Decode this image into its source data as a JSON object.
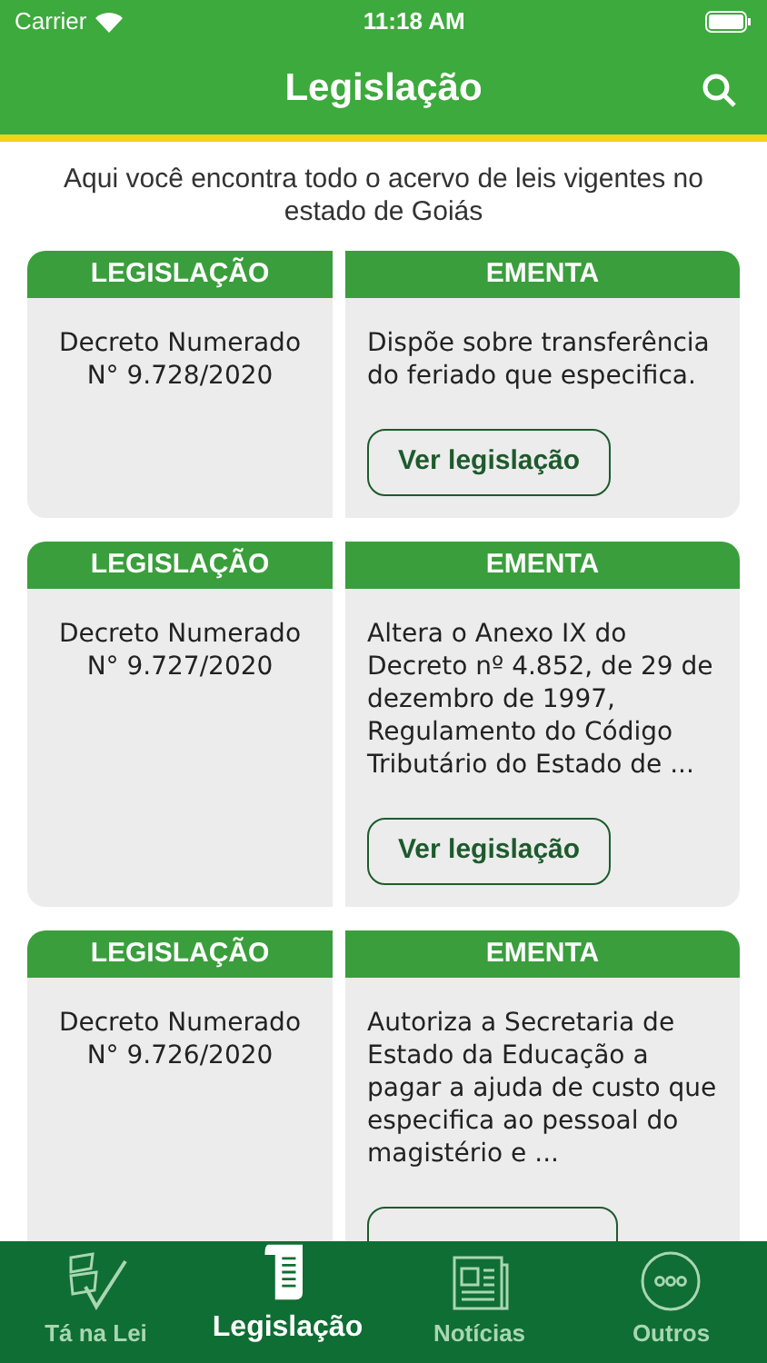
{
  "status_bar": {
    "carrier": "Carrier",
    "time": "11:18 AM"
  },
  "header": {
    "title": "Legislação"
  },
  "intro": "Aqui você encontra todo o acervo de leis vigentes no estado de Goiás",
  "cards": [
    {
      "left_heading": "LEGISLAÇÃO",
      "right_heading": "EMENTA",
      "law": "Decreto Numerado\nN° 9.728/2020",
      "summary": "Dispõe sobre transferência do feriado que especifica.",
      "button": "Ver legislação"
    },
    {
      "left_heading": "LEGISLAÇÃO",
      "right_heading": "EMENTA",
      "law": "Decreto Numerado\nN° 9.727/2020",
      "summary": "Altera o Anexo IX do Decreto nº 4.852, de 29 de dezembro de 1997, Regulamento do Código Tributário do Estado de ...",
      "button": "Ver legislação"
    },
    {
      "left_heading": "LEGISLAÇÃO",
      "right_heading": "EMENTA",
      "law": "Decreto Numerado\nN° 9.726/2020",
      "summary": "Autoriza a Secretaria de Estado da Educação a pagar a ajuda de custo que especifica ao pessoal do magistério e ..."
    }
  ],
  "tab_bar": [
    {
      "kind": "logo",
      "label": "Tá na Lei",
      "selected": false
    },
    {
      "kind": "scroll",
      "label": "Legislação",
      "selected": true
    },
    {
      "kind": "news",
      "label": "Notícias",
      "selected": false
    },
    {
      "kind": "more",
      "label": "Outros",
      "selected": false
    }
  ]
}
